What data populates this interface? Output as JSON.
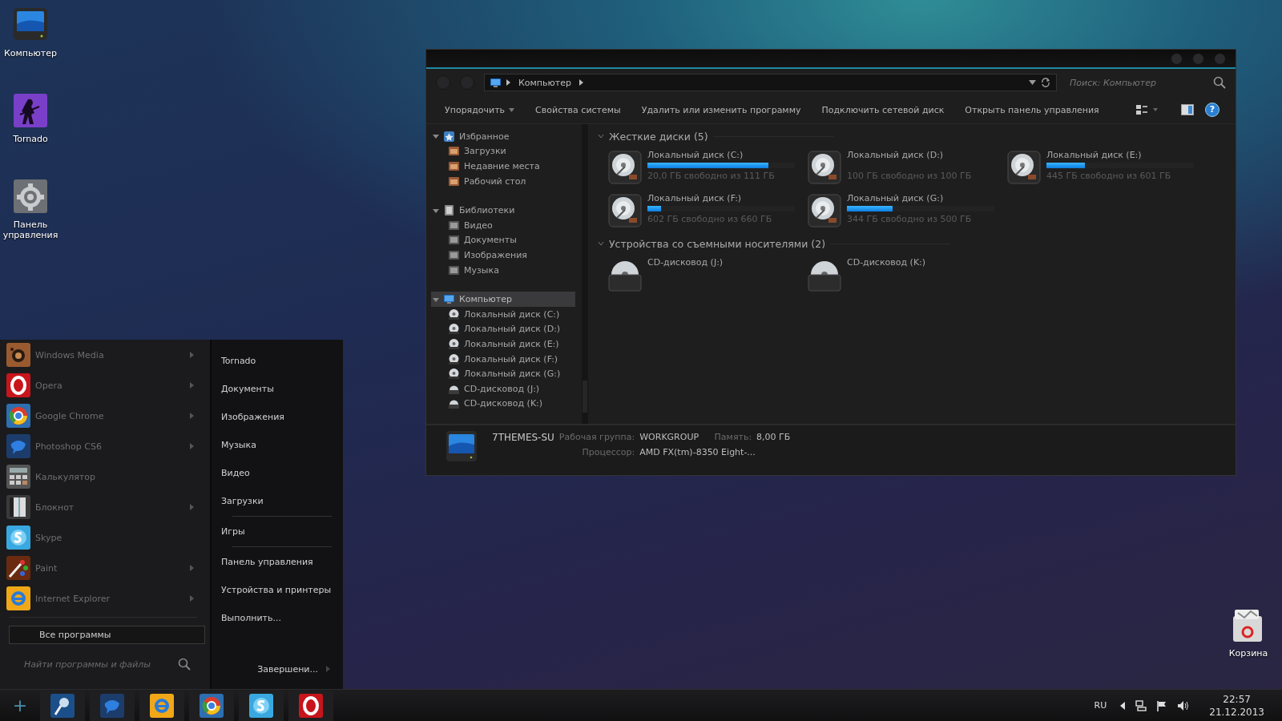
{
  "desktop": {
    "icons": [
      {
        "label": "Компьютер",
        "kind": "computer"
      },
      {
        "label": "Tornado",
        "kind": "artist"
      },
      {
        "label": "Панель управления",
        "kind": "gear"
      }
    ],
    "recycle_bin": {
      "label": "Корзина"
    }
  },
  "explorer": {
    "address": {
      "crumbs": [
        "Компьютер"
      ]
    },
    "search": {
      "placeholder": "Поиск: Компьютер"
    },
    "toolbar": [
      {
        "label": "Упорядочить",
        "dropdown": true
      },
      {
        "label": "Свойства системы",
        "dropdown": false
      },
      {
        "label": "Удалить или изменить программу",
        "dropdown": false
      },
      {
        "label": "Подключить сетевой диск",
        "dropdown": false
      },
      {
        "label": "Открыть панель управления",
        "dropdown": false
      }
    ],
    "help": "?",
    "nav": [
      {
        "label": "Избранное",
        "kind": "favorites",
        "expanded": true,
        "selected": false,
        "children": [
          {
            "label": "Загрузки",
            "kind": "folder",
            "selected": false
          },
          {
            "label": "Недавние места",
            "kind": "folder",
            "selected": false
          },
          {
            "label": "Рабочий стол",
            "kind": "folder",
            "selected": false
          }
        ]
      },
      {
        "label": "Библиотеки",
        "kind": "libraries",
        "expanded": true,
        "selected": false,
        "children": [
          {
            "label": "Видео",
            "kind": "library",
            "selected": false
          },
          {
            "label": "Документы",
            "kind": "library",
            "selected": false
          },
          {
            "label": "Изображения",
            "kind": "library",
            "selected": false
          },
          {
            "label": "Музыка",
            "kind": "library",
            "selected": false
          }
        ]
      },
      {
        "label": "Компьютер",
        "kind": "computer",
        "expanded": true,
        "selected": true,
        "children": [
          {
            "label": "Локальный диск (C:)",
            "kind": "hdd",
            "selected": false
          },
          {
            "label": "Локальный диск (D:)",
            "kind": "hdd",
            "selected": false
          },
          {
            "label": "Локальный диск (E:)",
            "kind": "hdd",
            "selected": false
          },
          {
            "label": "Локальный диск (F:)",
            "kind": "hdd",
            "selected": false
          },
          {
            "label": "Локальный диск (G:)",
            "kind": "hdd",
            "selected": false
          },
          {
            "label": "CD-дисковод (J:)",
            "kind": "cd",
            "selected": false
          },
          {
            "label": "CD-дисковод (K:)",
            "kind": "cd",
            "selected": false
          }
        ]
      }
    ],
    "groups": [
      {
        "title": "Жесткие диски (5)",
        "expanded": true,
        "items": [
          {
            "kind": "hdd",
            "name": "Локальный диск (C:)",
            "free": "20,0 ГБ свободно из 111 ГБ",
            "level": 0.82
          },
          {
            "kind": "hdd",
            "name": "Локальный диск (D:)",
            "free": "100 ГБ свободно из 100 ГБ"
          },
          {
            "kind": "hdd",
            "name": "Локальный диск (E:)",
            "free": "445 ГБ свободно из 601 ГБ",
            "level": 0.26
          },
          {
            "kind": "hdd",
            "name": "Локальный диск (F:)",
            "free": "602 ГБ свободно из 660 ГБ",
            "level": 0.09
          },
          {
            "kind": "hdd",
            "name": "Локальный диск (G:)",
            "free": "344 ГБ свободно из 500 ГБ",
            "level": 0.31
          }
        ]
      },
      {
        "title": "Устройства со съемными носителями (2)",
        "expanded": true,
        "items": [
          {
            "kind": "cd",
            "name": "CD-дисковод (J:)"
          },
          {
            "kind": "cd",
            "name": "CD-дисковод (K:)"
          }
        ]
      }
    ],
    "details": {
      "name": "7THEMES-SU",
      "fields": [
        {
          "label": "Рабочая группа:",
          "value": "WORKGROUP"
        },
        {
          "label": "Память:",
          "value": "8,00 ГБ"
        },
        {
          "label": "Процессор:",
          "value": "AMD FX(tm)-8350 Eight-..."
        }
      ]
    }
  },
  "start_menu": {
    "programs": [
      {
        "label": "Windows Media",
        "submenu": true
      },
      {
        "label": "Opera",
        "submenu": true
      },
      {
        "label": "Google Chrome",
        "submenu": true
      },
      {
        "label": "Photoshop CS6",
        "submenu": true
      },
      {
        "label": "Калькулятор",
        "submenu": false
      },
      {
        "label": "Блокнот",
        "submenu": true
      },
      {
        "label": "Skype",
        "submenu": false
      },
      {
        "label": "Paint",
        "submenu": true
      },
      {
        "label": "Internet Explorer",
        "submenu": true
      }
    ],
    "all_programs": "Все программы",
    "search": {
      "placeholder": "Найти программы и файлы"
    },
    "links": [
      {
        "kind": "link",
        "label": "Tornado"
      },
      {
        "kind": "link",
        "label": "Документы"
      },
      {
        "kind": "link",
        "label": "Изображения"
      },
      {
        "kind": "link",
        "label": "Музыка"
      },
      {
        "kind": "link",
        "label": "Видео"
      },
      {
        "kind": "link",
        "label": "Загрузки"
      },
      {
        "kind": "separator"
      },
      {
        "kind": "link",
        "label": "Игры"
      },
      {
        "kind": "separator"
      },
      {
        "kind": "link",
        "label": "Панель управления"
      },
      {
        "kind": "link",
        "label": "Устройства и принтеры"
      },
      {
        "kind": "link",
        "label": "Выполнить..."
      }
    ],
    "shutdown": {
      "label": "Завершени...",
      "submenu": true
    }
  },
  "taskbar": {
    "start": "+",
    "language": "RU",
    "time": "22:57",
    "date": "21.12.2013"
  }
}
